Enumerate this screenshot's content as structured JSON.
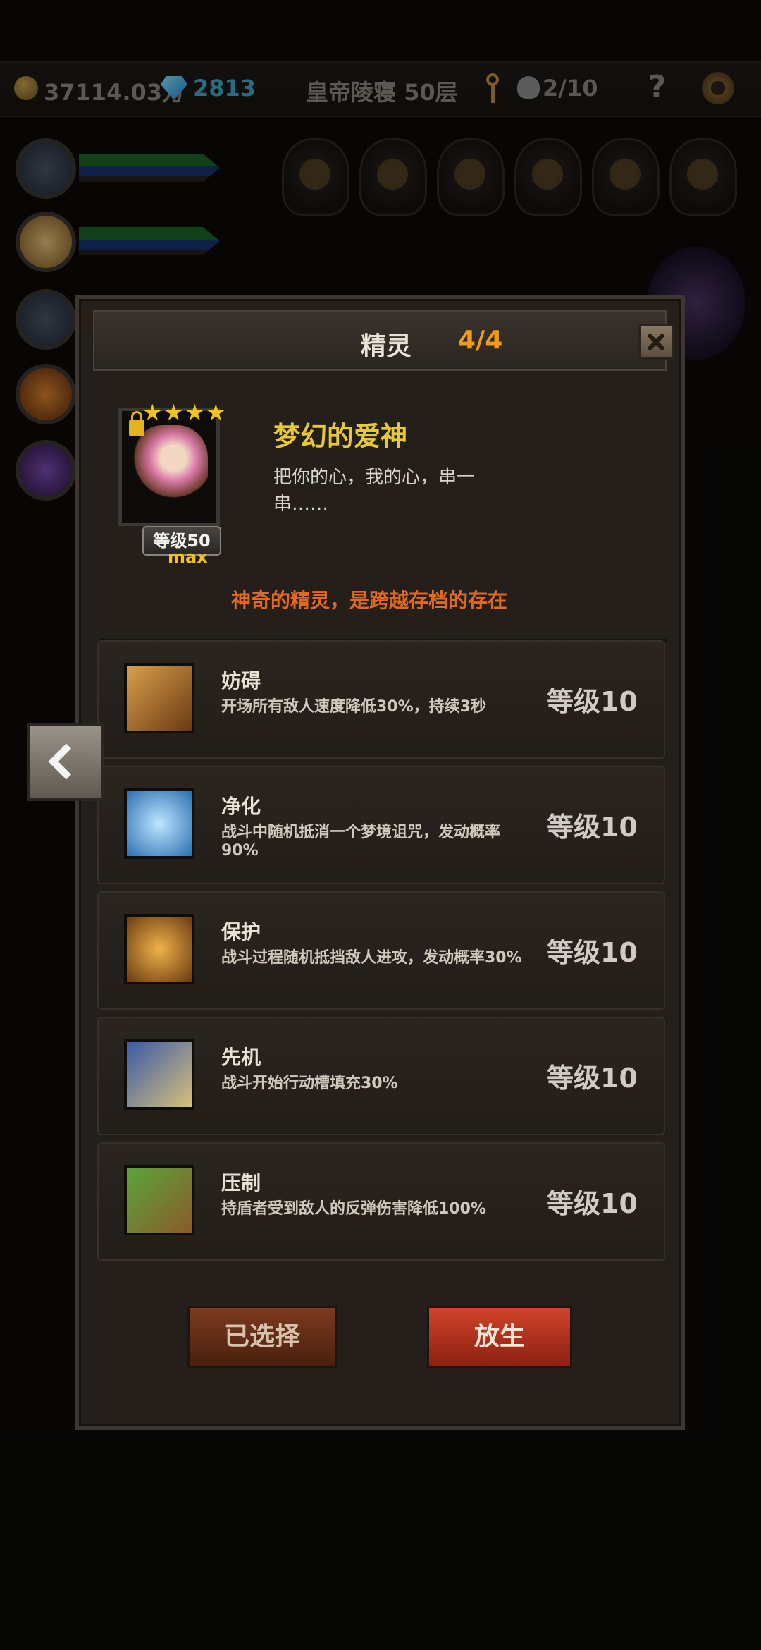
{
  "topbar": {
    "gold": "37114.03万",
    "gems": "2813",
    "stage": "皇帝陵寝 50层",
    "keys": "2/10",
    "help": "?"
  },
  "panel": {
    "title": "精灵",
    "count": "4/4"
  },
  "sprite": {
    "name": "梦幻的爱神",
    "description": "把你的心，我的心，串一串……",
    "level_label": "等级50",
    "max_label": "max",
    "stars": 4,
    "note": "神奇的精灵，是跨越存档的存在"
  },
  "skills": [
    {
      "name": "妨碍",
      "desc": "开场所有敌人速度降低30%，持续3秒",
      "level": "等级10",
      "icon": "chained-boot-icon"
    },
    {
      "name": "净化",
      "desc": "战斗中随机抵消一个梦境诅咒，发动概率90%",
      "level": "等级10",
      "icon": "blue-flower-icon"
    },
    {
      "name": "保护",
      "desc": "战斗过程随机抵挡敌人进攻，发动概率30%",
      "level": "等级10",
      "icon": "golden-shield-icon"
    },
    {
      "name": "先机",
      "desc": "战斗开始行动槽填充30%",
      "level": "等级10",
      "icon": "leopard-icon"
    },
    {
      "name": "压制",
      "desc": "持盾者受到敌人的反弹伤害降低100%",
      "level": "等级10",
      "icon": "beast-claw-icon"
    }
  ],
  "buttons": {
    "selected": "已选择",
    "release": "放生"
  },
  "colors": {
    "title_accent": "#f29a1a",
    "name_color": "#e6c83a",
    "note_color": "#e06a22",
    "release_button": "#d0432a"
  }
}
